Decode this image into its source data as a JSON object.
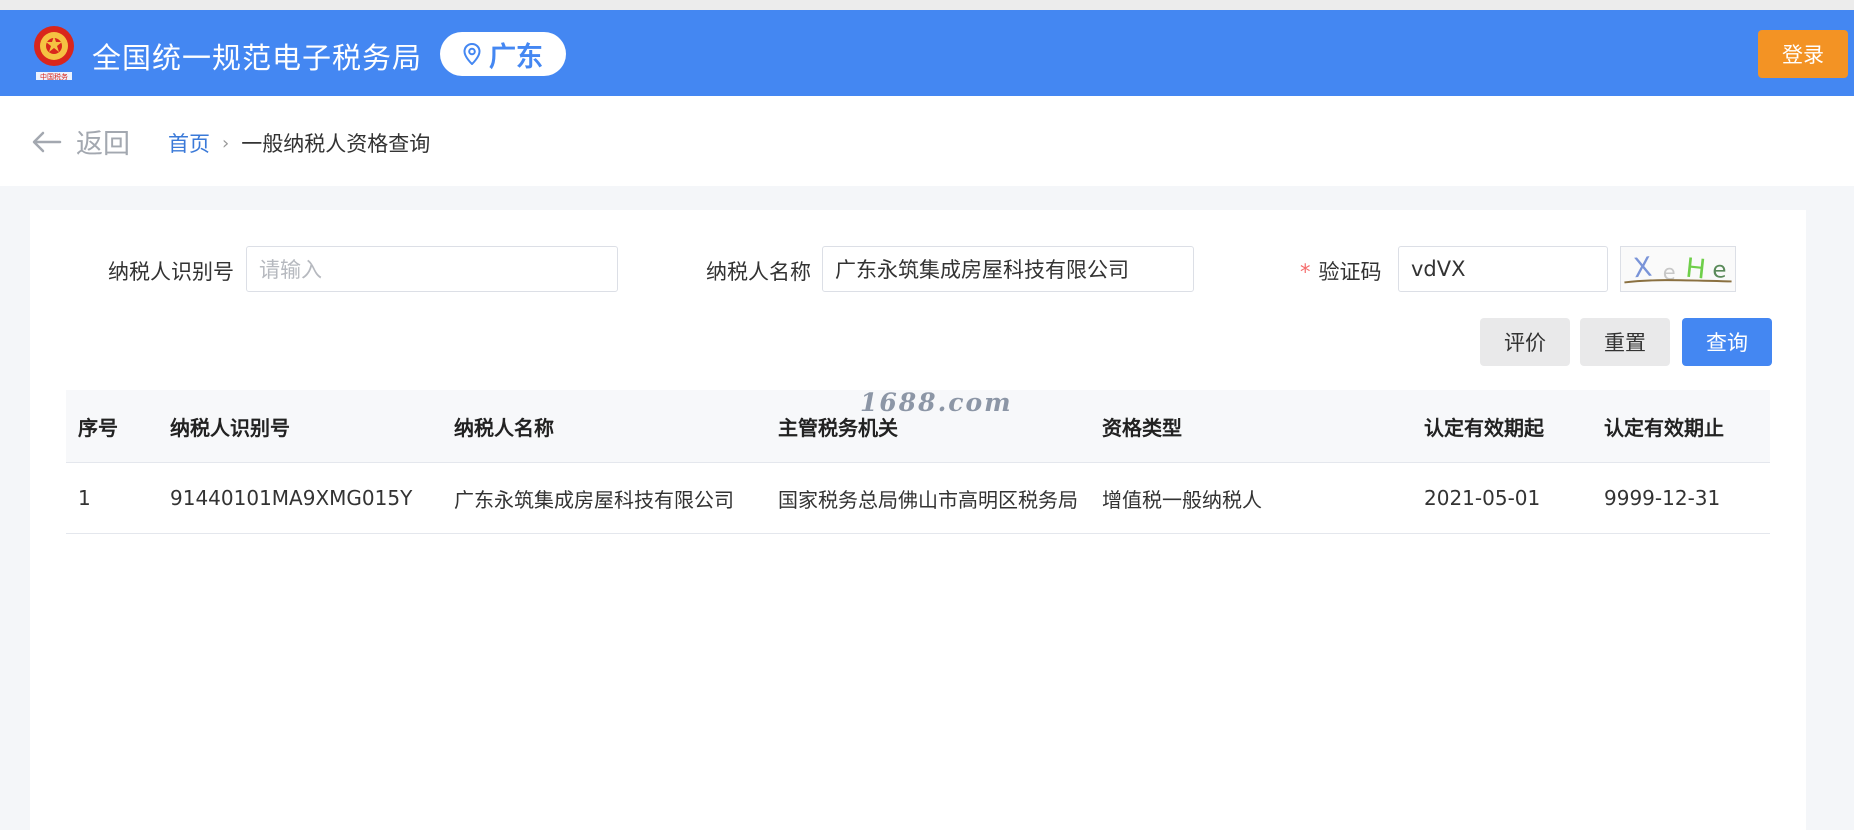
{
  "header": {
    "site_title": "全国统一规范电子税务局",
    "region": "广东",
    "login_label": "登录",
    "emblem_text": "中国税务"
  },
  "breadcrumb": {
    "back_label": "返回",
    "home": "首页",
    "separator": "›",
    "current": "一般纳税人资格查询"
  },
  "form": {
    "taxpayer_id": {
      "label": "纳税人识别号",
      "placeholder": "请输入",
      "value": ""
    },
    "taxpayer_name": {
      "label": "纳税人名称",
      "value": "广东永筑集成房屋科技有限公司"
    },
    "captcha": {
      "required_mark": "*",
      "label": "验证码",
      "value": "vdVX",
      "image_text": "XeHe"
    }
  },
  "buttons": {
    "evaluate": "评价",
    "reset": "重置",
    "query": "查询"
  },
  "table": {
    "headers": [
      "序号",
      "纳税人识别号",
      "纳税人名称",
      "主管税务机关",
      "资格类型",
      "认定有效期起",
      "认定有效期止"
    ],
    "rows": [
      [
        "1",
        "91440101MA9XMG015Y",
        "广东永筑集成房屋科技有限公司",
        "国家税务总局佛山市高明区税务局",
        "增值税一般纳税人",
        "2021-05-01",
        "9999-12-31"
      ]
    ]
  },
  "watermark": "1688.com",
  "colors": {
    "brand_blue": "#4487f2",
    "login_orange": "#f39324",
    "required_red": "#f56c6c"
  }
}
